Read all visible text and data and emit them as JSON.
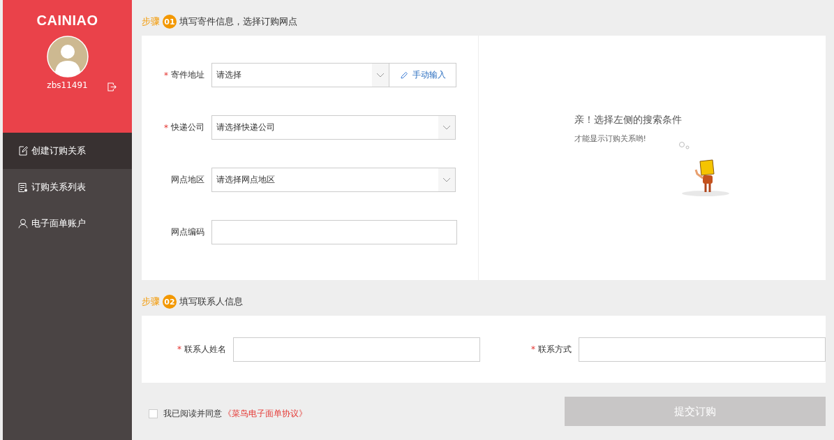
{
  "sidebar": {
    "logo": "CAINIAO",
    "username": "zbs11491",
    "items": [
      {
        "label": "创建订购关系",
        "selected": true
      },
      {
        "label": "订购关系列表",
        "selected": false
      },
      {
        "label": "电子面单账户",
        "selected": false
      }
    ]
  },
  "step1": {
    "prefix": "步骤",
    "number": "01",
    "title": "填写寄件信息，选择订购网点",
    "fields": [
      {
        "mark": "*",
        "label": "寄件地址",
        "kind": "select",
        "value": "请选择",
        "button": "手动输入"
      },
      {
        "mark": "*",
        "label": "快递公司",
        "kind": "select",
        "value": "请选择快递公司"
      },
      {
        "label": "网点地区",
        "kind": "select",
        "value": "请选择网点地区"
      },
      {
        "label": "网点编码",
        "kind": "text"
      }
    ],
    "hint": {
      "title": "亲！选择左侧的搜索条件",
      "subtitle": "才能显示订购关系哟!"
    }
  },
  "step2": {
    "prefix": "步骤",
    "number": "02",
    "title": "填写联系人信息",
    "fields": [
      {
        "mark": "*",
        "label": "联系人姓名"
      },
      {
        "mark": "*",
        "label": "联系方式"
      }
    ]
  },
  "agreement": {
    "checked": false,
    "text": "我已阅读并同意",
    "link": "《菜鸟电子面单协议》"
  },
  "submit": {
    "label": "提交订购",
    "disabled": true
  }
}
